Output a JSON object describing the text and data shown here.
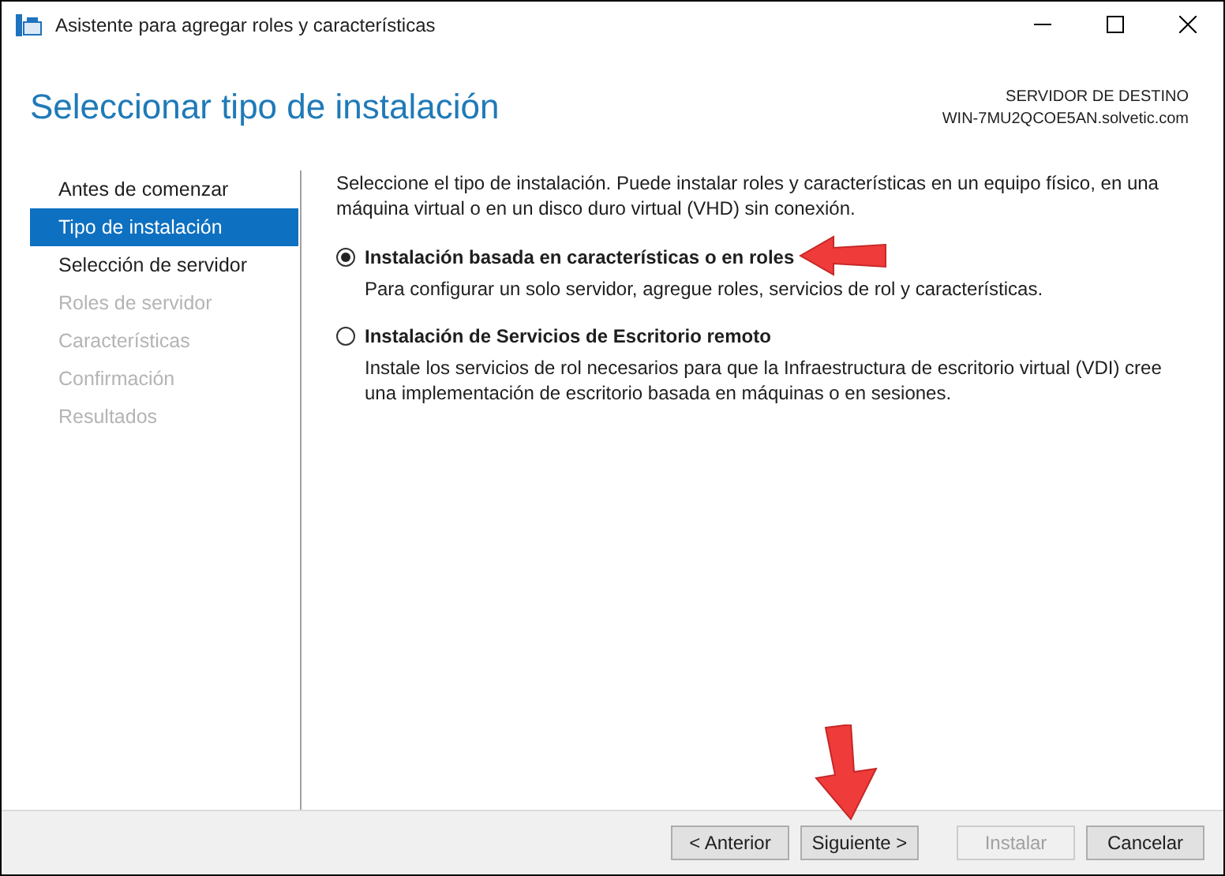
{
  "window": {
    "title": "Asistente para agregar roles y características"
  },
  "header": {
    "title": "Seleccionar tipo de instalación",
    "server_label": "SERVIDOR DE DESTINO",
    "server_name": "WIN-7MU2QCOE5AN.solvetic.com"
  },
  "sidebar": {
    "items": [
      {
        "label": "Antes de comenzar",
        "selected": false,
        "disabled": false
      },
      {
        "label": "Tipo de instalación",
        "selected": true,
        "disabled": false
      },
      {
        "label": "Selección de servidor",
        "selected": false,
        "disabled": false
      },
      {
        "label": "Roles de servidor",
        "selected": false,
        "disabled": true
      },
      {
        "label": "Características",
        "selected": false,
        "disabled": true
      },
      {
        "label": "Confirmación",
        "selected": false,
        "disabled": true
      },
      {
        "label": "Resultados",
        "selected": false,
        "disabled": true
      }
    ]
  },
  "intro": "Seleccione el tipo de instalación. Puede instalar roles y características en un equipo físico, en una máquina virtual o en un disco duro virtual (VHD) sin conexión.",
  "options": [
    {
      "label": "Instalación basada en características o en roles",
      "description": "Para configurar un solo servidor, agregue roles, servicios de rol y características.",
      "selected": true
    },
    {
      "label": "Instalación de Servicios de Escritorio remoto",
      "description": "Instale los servicios de rol necesarios para que la Infraestructura de escritorio virtual (VDI) cree una implementación de escritorio basada en máquinas o en sesiones.",
      "selected": false
    }
  ],
  "buttons": [
    {
      "label": "< Anterior",
      "disabled": false
    },
    {
      "label": "Siguiente >",
      "disabled": false
    },
    {
      "label": "Instalar",
      "disabled": true
    },
    {
      "label": "Cancelar",
      "disabled": false
    }
  ]
}
